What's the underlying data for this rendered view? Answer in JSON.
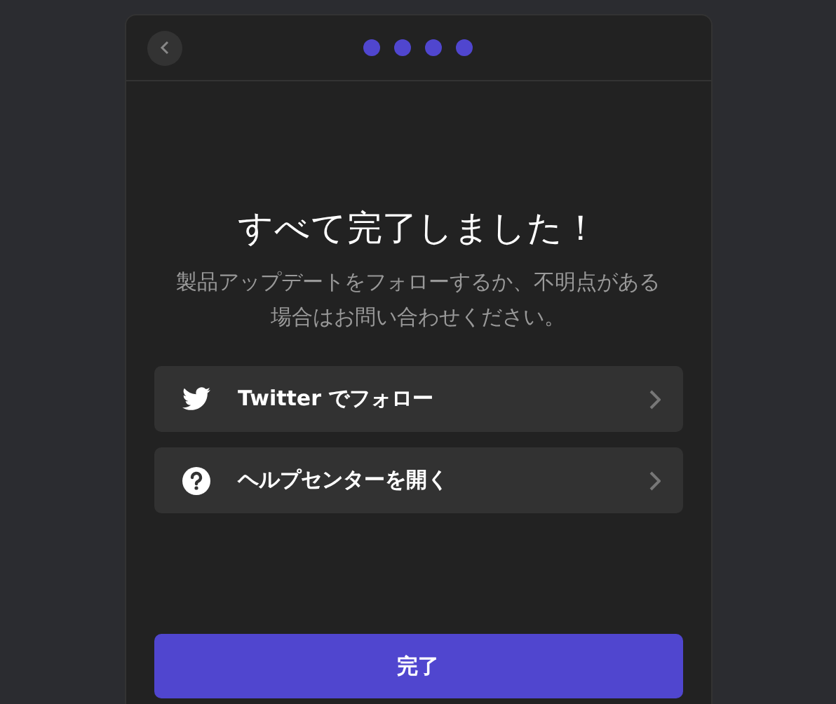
{
  "header": {
    "steps": [
      {
        "done": true
      },
      {
        "done": true
      },
      {
        "done": true
      },
      {
        "done": true
      }
    ]
  },
  "title": "すべて完了しました！",
  "subtitle": "製品アップデートをフォローするか、不明点がある場合はお問い合わせください。",
  "links": [
    {
      "kind": "twitter",
      "label": "Twitter でフォロー"
    },
    {
      "kind": "help",
      "label": "ヘルプセンターを開く"
    }
  ],
  "done_button": "完了"
}
